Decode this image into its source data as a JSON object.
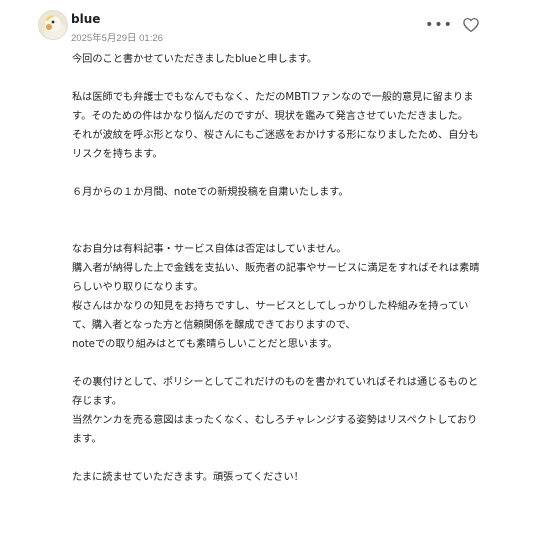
{
  "post": {
    "author": "blue",
    "timestamp": "2025年5月29日 01:26",
    "more_label": "•••",
    "lines": [
      "今回のこと書かせていただきましたblueと申します。",
      "",
      "私は医師でも弁護士でもなんでもなく、ただのMBTIファンなので一般的意見に留まりま",
      "す。そのための件はかなり悩んだのですが、現状を鑑みて発言させていただきました。",
      "それが波紋を呼ぶ形となり、桜さんにもご迷惑をおかけする形になりましたため、自分も",
      "リスクを持ちます。",
      "",
      "６月からの１か月間、noteでの新規投稿を自粛いたします。",
      "",
      "",
      "なお自分は有料記事・サービス自体は否定はしていません。",
      "購入者が納得した上で金銭を支払い、販売者の記事やサービスに満足をすればそれは素晴",
      "らしいやり取りになります。",
      "桜さんはかなりの知見をお持ちですし、サービスとしてしっかりした枠組みを持ってい",
      "て、購入者となった方と信頼関係を醸成できておりますので、",
      "noteでの取り組みはとても素晴らしいことだと思います。",
      "",
      "その裏付けとして、ポリシーとしてこれだけのものを書かれていればそれは通じるものと",
      "存じます。",
      "当然ケンカを売る意図はまったくなく、むしろチャレンジする姿勢はリスペクトしており",
      "ます。",
      "",
      "たまに読ませていただきます。頑張ってください！"
    ]
  },
  "icons": {
    "avatar": "bird-avatar-icon",
    "more": "more-options-icon",
    "like": "heart-icon"
  },
  "colors": {
    "text": "#222222",
    "meta": "#888888",
    "icon": "#555555",
    "background": "#ffffff"
  }
}
